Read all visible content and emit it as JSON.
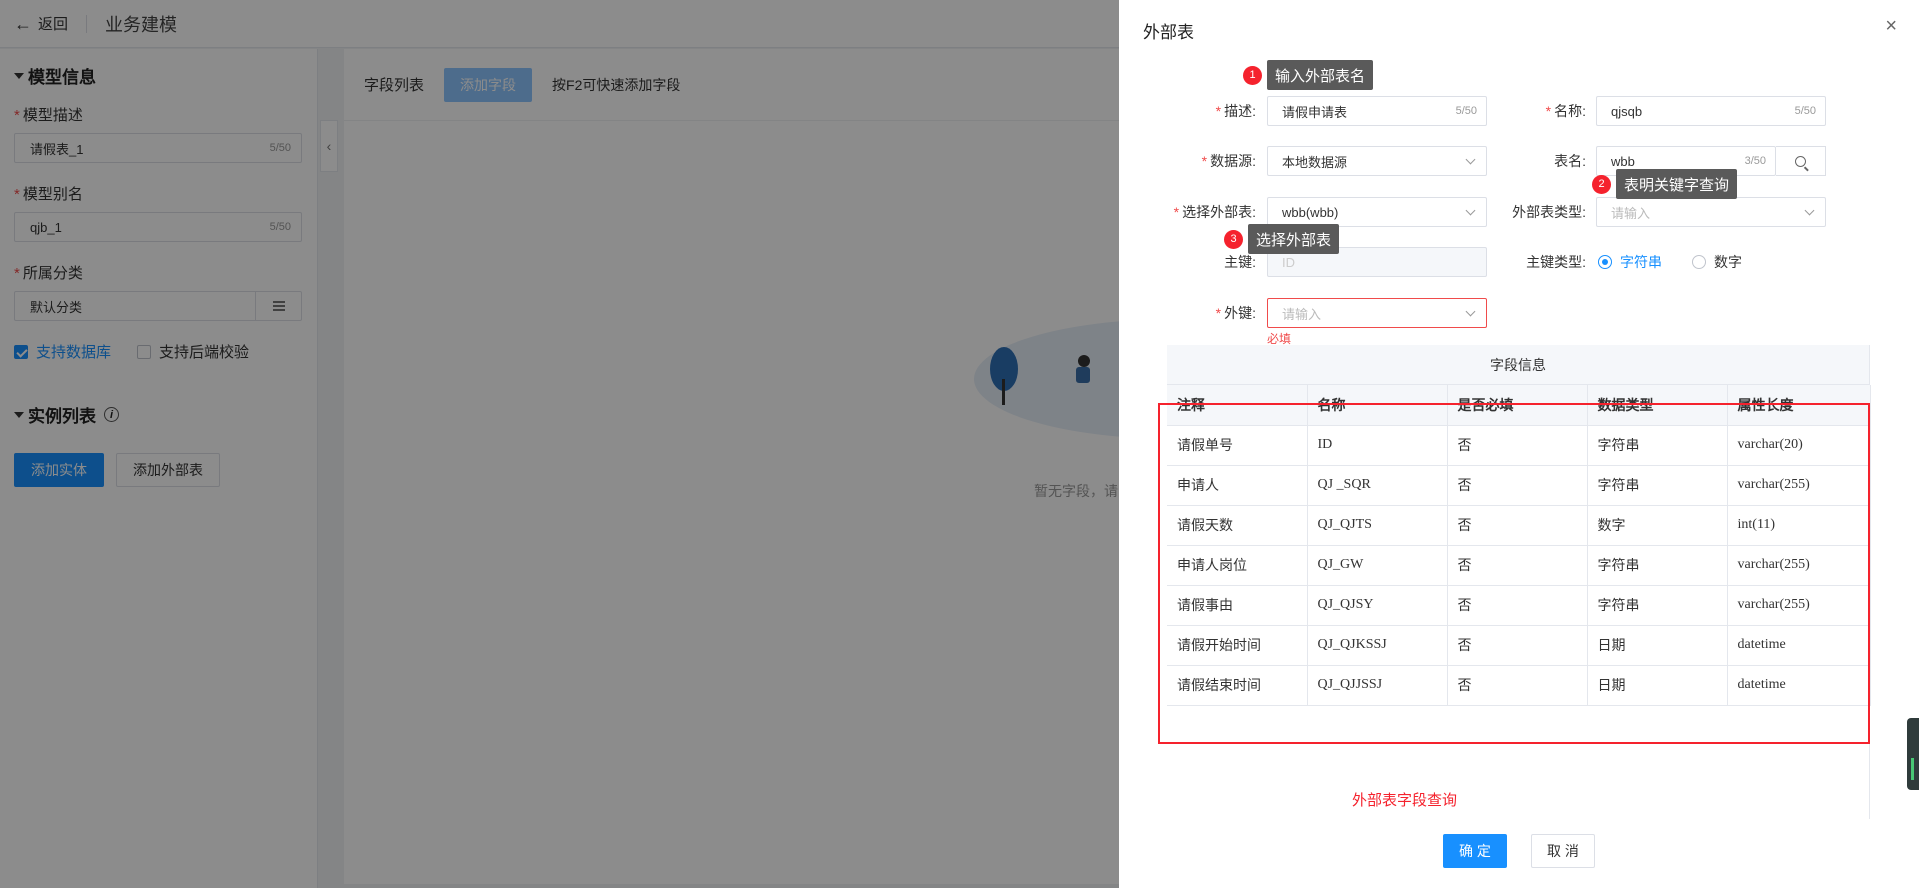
{
  "app": {
    "back_label": "返回",
    "page_title": "业务建模"
  },
  "model_info": {
    "section_title": "模型信息",
    "desc_label": "模型描述",
    "desc_value": "请假表_1",
    "desc_count": "5/50",
    "alias_label": "模型别名",
    "alias_value": "qjb_1",
    "alias_count": "5/50",
    "category_label": "所属分类",
    "category_value": "默认分类",
    "support_db_label": "支持数据库",
    "support_db_checked": true,
    "support_backend_label": "支持后端校验",
    "support_backend_checked": false
  },
  "instance_list": {
    "section_title": "实例列表",
    "add_entity_label": "添加实体",
    "add_external_label": "添加外部表"
  },
  "main": {
    "field_list_title": "字段列表",
    "add_field_label": "添加字段",
    "hint": "按F2可快速添加字段",
    "empty_text": "暂无字段，请"
  },
  "drawer": {
    "title": "外部表",
    "close_icon": "close-icon",
    "desc_label": "描述:",
    "desc_value": "请假申请表",
    "desc_count": "5/50",
    "name_label": "名称:",
    "name_value": "qjsqb",
    "name_count": "5/50",
    "datasource_label": "数据源:",
    "datasource_value": "本地数据源",
    "table_name_label": "表名:",
    "table_name_value": "wbb",
    "table_name_count": "3/50",
    "select_ext_label": "选择外部表:",
    "select_ext_value": "wbb(wbb)",
    "ext_type_label": "外部表类型:",
    "ext_type_placeholder": "请输入",
    "pk_label": "主键:",
    "pk_value": "ID",
    "pk_type_label": "主键类型:",
    "pk_type_options": [
      "字符串",
      "数字"
    ],
    "pk_type_selected": "字符串",
    "fk_label": "外键:",
    "fk_placeholder": "请输入",
    "fk_error": "必填",
    "tooltips": [
      {
        "num": "1",
        "text": "输入外部表名"
      },
      {
        "num": "2",
        "text": "表明关键字查询"
      },
      {
        "num": "3",
        "text": "选择外部表"
      }
    ],
    "table_caption": "字段信息",
    "columns": [
      "注释",
      "名称",
      "是否必填",
      "数据类型",
      "属性长度"
    ],
    "rows": [
      [
        "请假单号",
        "ID",
        "否",
        "字符串",
        "varchar(20)"
      ],
      [
        "申请人",
        "QJ _SQR",
        "否",
        "字符串",
        "varchar(255)"
      ],
      [
        "请假天数",
        "QJ_QJTS",
        "否",
        "数字",
        "int(11)"
      ],
      [
        "申请人岗位",
        "QJ_GW",
        "否",
        "字符串",
        "varchar(255)"
      ],
      [
        "请假事由",
        "QJ_QJSY",
        "否",
        "字符串",
        "varchar(255)"
      ],
      [
        "请假开始时间",
        "QJ_QJKSSJ",
        "否",
        "日期",
        "datetime"
      ],
      [
        "请假结束时间",
        "QJ_QJJSSJ",
        "否",
        "日期",
        "datetime"
      ]
    ],
    "annotation": "外部表字段查询",
    "ok_label": "确 定",
    "cancel_label": "取 消"
  },
  "colors": {
    "primary": "#1890ff",
    "danger": "#f5222d"
  }
}
